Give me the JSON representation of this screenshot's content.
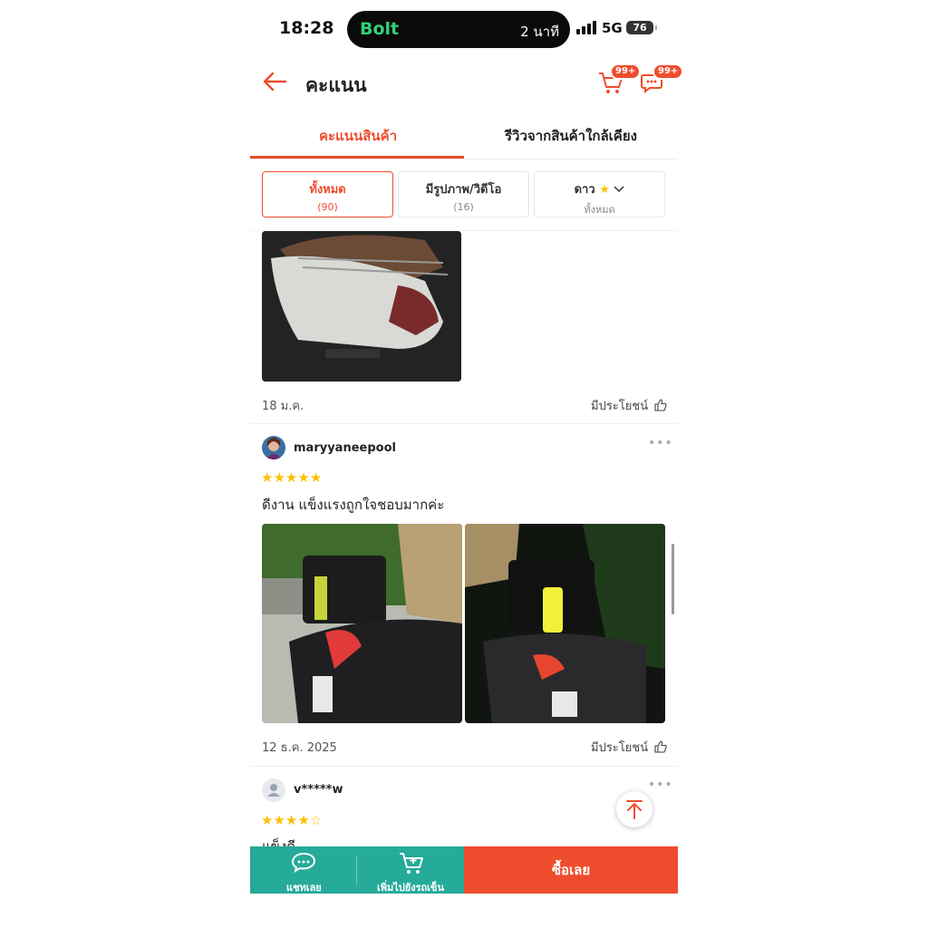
{
  "status_bar": {
    "time": "18:28",
    "app_label": "Bolt",
    "app_time": "2 นาที",
    "network": "5G",
    "battery": "76"
  },
  "header": {
    "title": "คะแนน",
    "cart_badge": "99+",
    "chat_badge": "99+"
  },
  "tabs": [
    {
      "label": "คะแนนสินค้า",
      "active": true
    },
    {
      "label": "รีวิวจากสินค้าใกล้เคียง",
      "active": false
    }
  ],
  "filters": [
    {
      "label": "ทั้งหมด",
      "sub": "(90)",
      "active": true
    },
    {
      "label": "มีรูปภาพ/วิดีโอ",
      "sub": "(16)",
      "active": false
    },
    {
      "label": "ดาว",
      "sub": "ทั้งหมด",
      "active": false
    }
  ],
  "reviews": [
    {
      "date": "18 ม.ค.",
      "helpful": "มีประโยชน์"
    },
    {
      "username": "maryyaneepool",
      "rating": 5,
      "comment": "ดีงาน แข็งแรงถูกใจชอบมากค่ะ",
      "date": "12 ธ.ค. 2025",
      "helpful": "มีประโยชน์"
    },
    {
      "username": "v*****w",
      "rating": 4,
      "comment": "แข็งดี---------"
    }
  ],
  "bottom_bar": {
    "chat_label": "แชทเลย",
    "cart_label": "เพิ่มไปยังรถเข็น",
    "buy_label": "ซื้อเลย"
  },
  "colors": {
    "accent": "#ee4d2d",
    "teal": "#26aa99",
    "star": "#ffbf00"
  },
  "icons": [
    "back-arrow-icon",
    "cart-icon",
    "chat-icon",
    "star-icon",
    "chevron-down-icon",
    "thumbs-up-icon",
    "more-icon",
    "user-icon",
    "arrow-up-icon",
    "cart-plus-icon"
  ]
}
